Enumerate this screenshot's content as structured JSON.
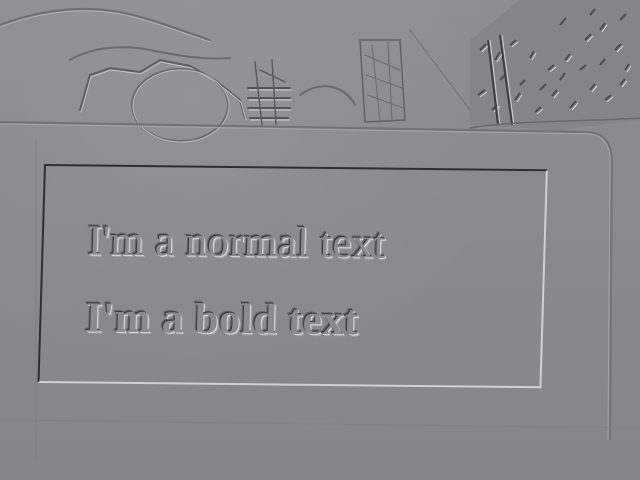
{
  "image": {
    "style": "grayscale-emboss",
    "colors": {
      "base": "#8a8a8c",
      "shadow": "#3a3a3c",
      "highlight": "#d7d7d9"
    }
  },
  "embossed_plate": {
    "lines": [
      {
        "text": "I'm a normal text",
        "weight": "normal"
      },
      {
        "text": "I'm a bold text",
        "weight": "bold"
      }
    ]
  }
}
